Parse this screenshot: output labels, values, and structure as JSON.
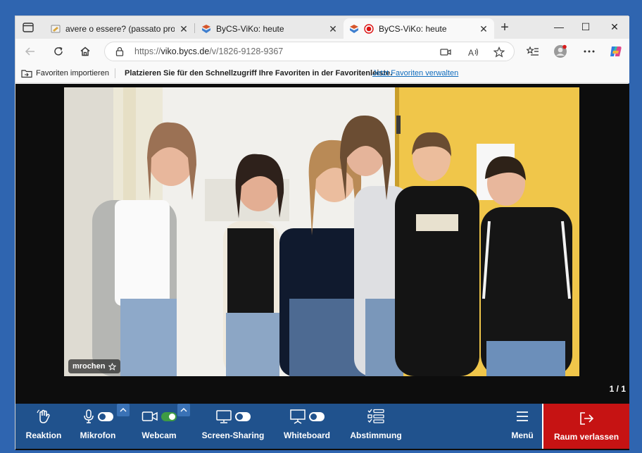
{
  "tabs": [
    {
      "title": "avere o essere? (passato prossimo",
      "active": false,
      "favicon": "note-favicon"
    },
    {
      "title": "ByCS-ViKo: heute",
      "active": false,
      "favicon": "bycs-favicon"
    },
    {
      "title": "ByCS-ViKo: heute",
      "active": true,
      "favicon": "bycs-favicon",
      "recording": true
    }
  ],
  "address": {
    "scheme": "https://",
    "host": "viko.bycs.de",
    "path": "/v/1826-9128-9367"
  },
  "favorites_bar": {
    "import_label": "Favoriten importieren",
    "hint": "Platzieren Sie für den Schnellzugriff Ihre Favoriten in der Favoritenleiste.",
    "manage_link": "Jetzt Favoriten verwalten"
  },
  "video": {
    "participant_name": "mrochen",
    "pager": "1 / 1"
  },
  "controls": {
    "reaction": "Reaktion",
    "microphone": "Mikrofon",
    "microphone_on": false,
    "webcam": "Webcam",
    "webcam_on": true,
    "screen_sharing": "Screen-Sharing",
    "screen_sharing_on": false,
    "whiteboard": "Whiteboard",
    "whiteboard_on": false,
    "poll": "Abstimmung",
    "menu": "Menü",
    "leave": "Raum verlassen"
  },
  "colors": {
    "desktop": "#2f65b0",
    "control_bar": "#20528d",
    "leave_button": "#c61313",
    "webcam_active": "#3e9b44",
    "link": "#0f6cbd"
  }
}
